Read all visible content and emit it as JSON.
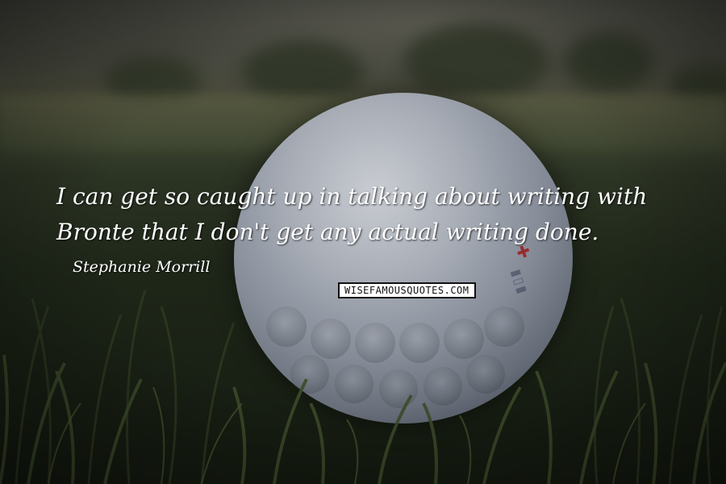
{
  "quote": {
    "line1": "I can get so caught up in talking about writing with",
    "line2": "Bronte that I don't get any actual writing done."
  },
  "author": "Stephanie Morrill",
  "watermark": "WISEFAMOUSQUOTES.COM",
  "colors": {
    "text": "#ffffff",
    "grass": "#1f2719",
    "ball": "#a9aeb7",
    "ball_mark": "#9d1a1a"
  }
}
